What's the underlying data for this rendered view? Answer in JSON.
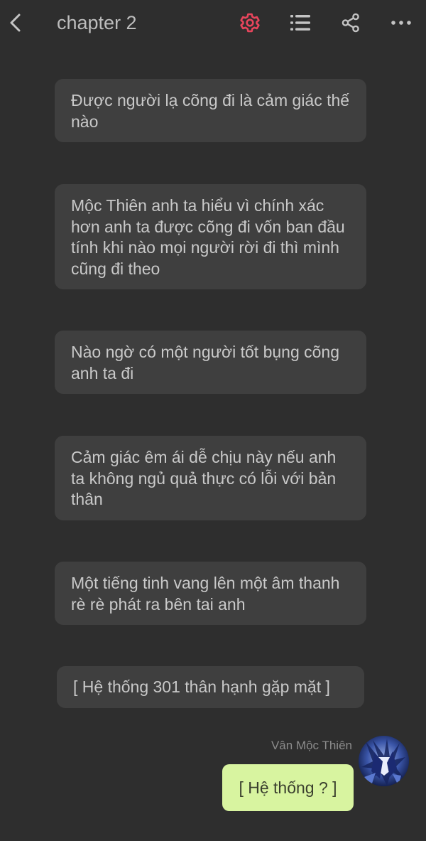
{
  "header": {
    "title": "chapter 2",
    "icons": [
      "back-arrow",
      "settings-gear",
      "list",
      "share",
      "more-dots"
    ],
    "accent": "#e8455c"
  },
  "messages": [
    {
      "text": "Được người lạ cõng đi là cảm giác thế nào"
    },
    {
      "text": "Mộc Thiên anh ta hiểu vì chính xác hơn anh ta được cõng đi vốn ban đầu tính khi nào mọi người rời đi thì mình cũng đi theo"
    },
    {
      "text": "Nào ngờ có một người tốt bụng cõng anh ta đi"
    },
    {
      "text": "Cảm giác êm ái dễ chịu này nếu anh ta không ngủ quả thực có lỗi với bản thân"
    },
    {
      "text": "Một tiếng tinh vang lên một âm thanh rè rè phát ra bên tai anh"
    },
    {
      "text": "[ Hệ thống 301 thân hạnh gặp mặt ]"
    }
  ],
  "reply": {
    "sender": "Vân Mộc Thiên",
    "text": "[ Hệ thống ? ]",
    "bubble_color": "#d8f4a0"
  },
  "colors": {
    "background": "#2e2e2e",
    "bubble": "#3f3f3f"
  }
}
